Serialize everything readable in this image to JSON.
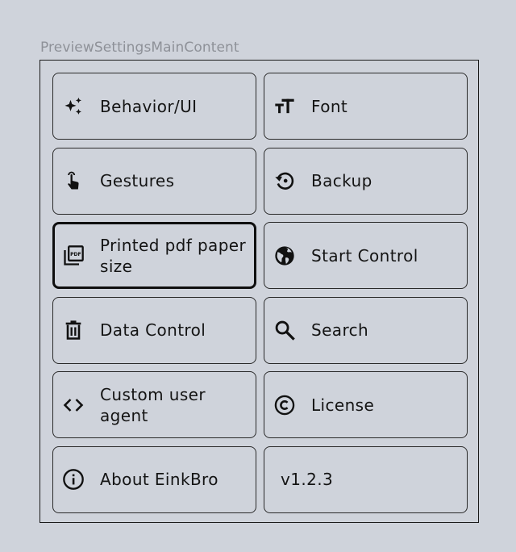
{
  "preview_title": "PreviewSettingsMainContent",
  "items": [
    {
      "label": "Behavior/UI",
      "icon": "sparkles-icon"
    },
    {
      "label": "Font",
      "icon": "text-size-icon"
    },
    {
      "label": "Gestures",
      "icon": "touch-icon"
    },
    {
      "label": "Backup",
      "icon": "restore-icon"
    },
    {
      "label": "Printed pdf paper size",
      "icon": "pdf-icon"
    },
    {
      "label": "Start Control",
      "icon": "globe-icon"
    },
    {
      "label": "Data Control",
      "icon": "trash-icon"
    },
    {
      "label": "Search",
      "icon": "search-icon"
    },
    {
      "label": "Custom user agent",
      "icon": "code-icon"
    },
    {
      "label": "License",
      "icon": "copyright-icon"
    },
    {
      "label": "About EinkBro",
      "icon": "info-icon"
    },
    {
      "label": "v1.2.3"
    }
  ]
}
